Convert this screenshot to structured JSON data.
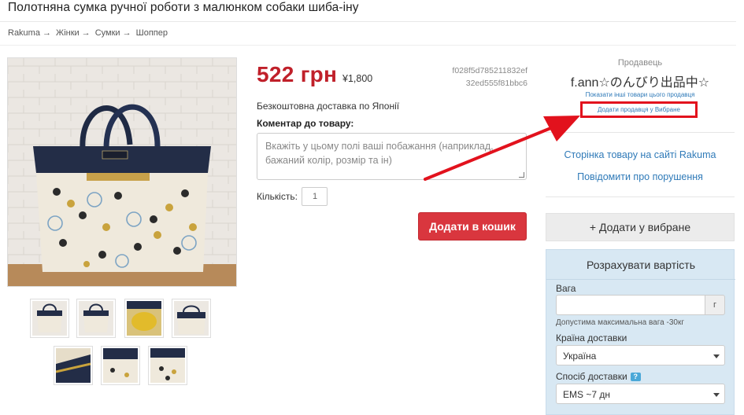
{
  "page": {
    "title": "Полотняна сумка ручної роботи з малюнком собаки шиба-іну",
    "breadcrumb": [
      "Rakuma",
      "Жінки",
      "Сумки",
      "Шоппер"
    ],
    "breadcrumb_sep": "→"
  },
  "gallery": {
    "main_image": "tote-bag-photo",
    "thumbnails": [
      "thumb-1",
      "thumb-2",
      "thumb-3",
      "thumb-4",
      "thumb-5",
      "thumb-6",
      "thumb-7"
    ]
  },
  "product": {
    "price": "522 грн",
    "price_yen": "¥1,800",
    "code_line1": "f028f5d785211832ef",
    "code_line2": "32ed555f81bbc6",
    "shipping": "Безкоштовна доставка по Японії",
    "comment_label": "Коментар до товару:",
    "comment_placeholder": "Вкажіть у цьому полі ваші побажання (наприклад, бажаний колір, розмір та ін)",
    "quantity_label": "Кількість:",
    "quantity_value": "1",
    "add_to_cart": "Додати в кошик"
  },
  "seller": {
    "label": "Продавець",
    "name": "f.ann☆のんびり出品中☆",
    "show_other": "Показати інші товари цього продавця",
    "add_favorite": "Додати продавця у Вибране"
  },
  "links": {
    "rakuma_page": "Сторінка товару на сайті Rakuma",
    "report": "Повідомити про порушення"
  },
  "favorite_button": "+ Додати у вибране",
  "calculator": {
    "title": "Розрахувати вартість",
    "weight_label": "Вага",
    "weight_value": "",
    "weight_unit": "г",
    "weight_hint": "Допустима максимальна вага -30кг",
    "country_label": "Країна доставки",
    "country_value": "Україна",
    "method_label": "Спосіб доставки",
    "method_help": "?",
    "method_value": "EMS ~7 дн"
  },
  "colors": {
    "price_red": "#c0202a",
    "cart_button": "#d9363e",
    "link_blue": "#2f7ab8",
    "annotation_red": "#e2121d",
    "calc_bg": "#d8e8f3"
  }
}
